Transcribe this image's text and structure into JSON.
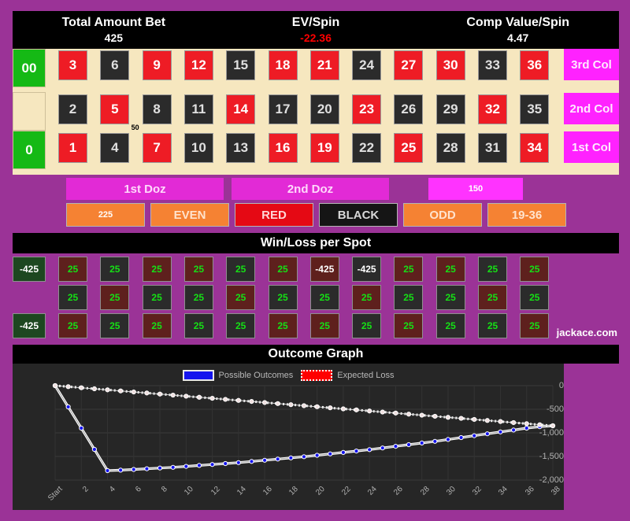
{
  "summary": {
    "items": [
      {
        "label": "Total Amount Bet",
        "value": "425",
        "negative": false
      },
      {
        "label": "EV/Spin",
        "value": "-22.36",
        "negative": true
      },
      {
        "label": "Comp Value/Spin",
        "value": "4.47",
        "negative": false
      }
    ]
  },
  "board": {
    "zeros": [
      {
        "label": "00",
        "type": "green"
      },
      {
        "label": "",
        "type": "blank"
      },
      {
        "label": "0",
        "type": "green"
      }
    ],
    "rows": [
      {
        "name": "3rd Col",
        "numbers": [
          {
            "n": "3",
            "color": "red"
          },
          {
            "n": "6",
            "color": "black"
          },
          {
            "n": "9",
            "color": "red"
          },
          {
            "n": "12",
            "color": "red"
          },
          {
            "n": "15",
            "color": "black"
          },
          {
            "n": "18",
            "color": "red"
          },
          {
            "n": "21",
            "color": "red"
          },
          {
            "n": "24",
            "color": "black"
          },
          {
            "n": "27",
            "color": "red"
          },
          {
            "n": "30",
            "color": "red"
          },
          {
            "n": "33",
            "color": "black"
          },
          {
            "n": "36",
            "color": "red"
          }
        ]
      },
      {
        "name": "2nd Col",
        "numbers": [
          {
            "n": "2",
            "color": "black"
          },
          {
            "n": "5",
            "color": "red"
          },
          {
            "n": "8",
            "color": "black"
          },
          {
            "n": "11",
            "color": "black"
          },
          {
            "n": "14",
            "color": "red"
          },
          {
            "n": "17",
            "color": "black"
          },
          {
            "n": "20",
            "color": "black"
          },
          {
            "n": "23",
            "color": "red"
          },
          {
            "n": "26",
            "color": "black"
          },
          {
            "n": "29",
            "color": "black"
          },
          {
            "n": "32",
            "color": "red"
          },
          {
            "n": "35",
            "color": "black"
          }
        ]
      },
      {
        "name": "1st Col",
        "numbers": [
          {
            "n": "1",
            "color": "red"
          },
          {
            "n": "4",
            "color": "black"
          },
          {
            "n": "7",
            "color": "red"
          },
          {
            "n": "10",
            "color": "black"
          },
          {
            "n": "13",
            "color": "black"
          },
          {
            "n": "16",
            "color": "red"
          },
          {
            "n": "19",
            "color": "red"
          },
          {
            "n": "22",
            "color": "black"
          },
          {
            "n": "25",
            "color": "red"
          },
          {
            "n": "28",
            "color": "black"
          },
          {
            "n": "31",
            "color": "black"
          },
          {
            "n": "34",
            "color": "red"
          }
        ]
      }
    ],
    "corner_chip": {
      "amount": "50"
    }
  },
  "outside": {
    "dozens": [
      {
        "label": "1st Doz",
        "is_chip": false
      },
      {
        "label": "2nd Doz",
        "is_chip": false
      },
      {
        "label": "150",
        "is_chip": true
      }
    ],
    "evens": [
      {
        "label": "225",
        "style": "orange",
        "is_chip": true
      },
      {
        "label": "EVEN",
        "style": "orange",
        "is_chip": false
      },
      {
        "label": "RED",
        "style": "red",
        "is_chip": false
      },
      {
        "label": "BLACK",
        "style": "black",
        "is_chip": false
      },
      {
        "label": "ODD",
        "style": "orange",
        "is_chip": false
      },
      {
        "label": "19-36",
        "style": "orange",
        "is_chip": false
      }
    ]
  },
  "winloss": {
    "title": "Win/Loss per Spot",
    "brand": "jackace.com",
    "zeros": [
      {
        "label": "-425",
        "show": true
      },
      {
        "label": "",
        "show": false
      },
      {
        "label": "-425",
        "show": true
      }
    ],
    "rows": [
      {
        "cells": [
          {
            "v": "25",
            "color": "red",
            "loss": false
          },
          {
            "v": "25",
            "color": "black",
            "loss": false
          },
          {
            "v": "25",
            "color": "red",
            "loss": false
          },
          {
            "v": "25",
            "color": "red",
            "loss": false
          },
          {
            "v": "25",
            "color": "black",
            "loss": false
          },
          {
            "v": "25",
            "color": "red",
            "loss": false
          },
          {
            "v": "-425",
            "color": "red",
            "loss": true
          },
          {
            "v": "-425",
            "color": "black",
            "loss": true
          },
          {
            "v": "25",
            "color": "red",
            "loss": false
          },
          {
            "v": "25",
            "color": "red",
            "loss": false
          },
          {
            "v": "25",
            "color": "black",
            "loss": false
          },
          {
            "v": "25",
            "color": "red",
            "loss": false
          }
        ]
      },
      {
        "cells": [
          {
            "v": "25",
            "color": "black",
            "loss": false
          },
          {
            "v": "25",
            "color": "red",
            "loss": false
          },
          {
            "v": "25",
            "color": "black",
            "loss": false
          },
          {
            "v": "25",
            "color": "black",
            "loss": false
          },
          {
            "v": "25",
            "color": "red",
            "loss": false
          },
          {
            "v": "25",
            "color": "black",
            "loss": false
          },
          {
            "v": "25",
            "color": "black",
            "loss": false
          },
          {
            "v": "25",
            "color": "red",
            "loss": false
          },
          {
            "v": "25",
            "color": "black",
            "loss": false
          },
          {
            "v": "25",
            "color": "black",
            "loss": false
          },
          {
            "v": "25",
            "color": "red",
            "loss": false
          },
          {
            "v": "25",
            "color": "black",
            "loss": false
          }
        ]
      },
      {
        "cells": [
          {
            "v": "25",
            "color": "red",
            "loss": false
          },
          {
            "v": "25",
            "color": "black",
            "loss": false
          },
          {
            "v": "25",
            "color": "red",
            "loss": false
          },
          {
            "v": "25",
            "color": "black",
            "loss": false
          },
          {
            "v": "25",
            "color": "black",
            "loss": false
          },
          {
            "v": "25",
            "color": "red",
            "loss": false
          },
          {
            "v": "25",
            "color": "red",
            "loss": false
          },
          {
            "v": "25",
            "color": "black",
            "loss": false
          },
          {
            "v": "25",
            "color": "red",
            "loss": false
          },
          {
            "v": "25",
            "color": "black",
            "loss": false
          },
          {
            "v": "25",
            "color": "black",
            "loss": false
          },
          {
            "v": "25",
            "color": "red",
            "loss": false
          }
        ]
      }
    ]
  },
  "chart_data": {
    "type": "line",
    "title": "Outcome Graph",
    "xlabel": "",
    "ylabel": "",
    "grid": true,
    "legend_position": "top-center",
    "ylim": [
      -2000,
      0
    ],
    "yticks": [
      0,
      -500,
      -1000,
      -1500,
      -2000
    ],
    "ytick_labels": [
      "0",
      "-500",
      "-1,000",
      "-1,500",
      "-2,000"
    ],
    "x": [
      "Start",
      "1",
      "2",
      "3",
      "4",
      "5",
      "6",
      "7",
      "8",
      "9",
      "10",
      "11",
      "12",
      "13",
      "14",
      "15",
      "16",
      "17",
      "18",
      "19",
      "20",
      "21",
      "22",
      "23",
      "24",
      "25",
      "26",
      "27",
      "28",
      "29",
      "30",
      "31",
      "32",
      "33",
      "34",
      "35",
      "36",
      "37",
      "38"
    ],
    "xtick_labels": [
      "Start",
      "2",
      "4",
      "6",
      "8",
      "10",
      "12",
      "14",
      "16",
      "18",
      "20",
      "22",
      "24",
      "26",
      "28",
      "30",
      "32",
      "34",
      "36",
      "38"
    ],
    "series": [
      {
        "name": "Possible Outcomes",
        "color": "#1414ee",
        "style": "solid",
        "values": [
          0,
          -450,
          -900,
          -1350,
          -1800,
          -1790,
          -1775,
          -1760,
          -1745,
          -1730,
          -1710,
          -1690,
          -1670,
          -1650,
          -1630,
          -1605,
          -1580,
          -1555,
          -1530,
          -1505,
          -1475,
          -1445,
          -1415,
          -1385,
          -1355,
          -1320,
          -1285,
          -1250,
          -1215,
          -1180,
          -1140,
          -1100,
          -1060,
          -1020,
          -980,
          -940,
          -900,
          -870,
          -850
        ]
      },
      {
        "name": "Expected Loss",
        "color": "#ff0000",
        "style": "dotted",
        "values": [
          0,
          -22,
          -45,
          -67,
          -89,
          -112,
          -134,
          -156,
          -179,
          -201,
          -224,
          -246,
          -268,
          -291,
          -313,
          -335,
          -358,
          -380,
          -403,
          -425,
          -447,
          -470,
          -492,
          -514,
          -537,
          -559,
          -581,
          -604,
          -626,
          -649,
          -671,
          -693,
          -716,
          -738,
          -760,
          -783,
          -805,
          -828,
          -850
        ]
      }
    ]
  }
}
